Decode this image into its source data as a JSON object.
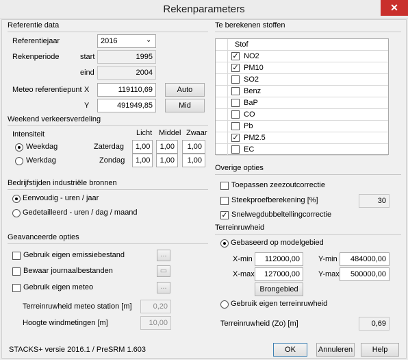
{
  "window": {
    "title": "Rekenparameters",
    "close_glyph": "✕"
  },
  "referentie": {
    "section": "Referentie data",
    "jaar_label": "Referentiejaar",
    "jaar_value": "2016",
    "periode_label": "Rekenperiode",
    "start_label": "start",
    "start_value": "1995",
    "eind_label": "eind",
    "eind_value": "2004",
    "meteo_label": "Meteo referentiepunt",
    "x_label": "X",
    "x_value": "119110,69",
    "y_label": "Y",
    "y_value": "491949,85",
    "auto_btn": "Auto",
    "mid_btn": "Mid"
  },
  "weekend": {
    "section": "Weekend verkeersverdeling",
    "intensiteit_label": "Intensiteit",
    "col_licht": "Licht",
    "col_middel": "Middel",
    "col_zwaar": "Zwaar",
    "weekdag_label": "Weekdag",
    "werkdag_label": "Werkdag",
    "zaterdag_label": "Zaterdag",
    "zondag_label": "Zondag",
    "zaterdag_values": [
      "1,00",
      "1,00",
      "1,00"
    ],
    "zondag_values": [
      "1,00",
      "1,00",
      "1,00"
    ]
  },
  "bedrijf": {
    "section": "Bedrijfstijden industriële bronnen",
    "opt1": "Eenvoudig - uren / jaar",
    "opt2": "Gedetailleerd - uren / dag / maand"
  },
  "geavanceerd": {
    "section": "Geavanceerde opties",
    "opt_emissie": "Gebruik eigen emissiebestand",
    "opt_journaal": "Bewaar journaalbestanden",
    "opt_meteo": "Gebruik eigen meteo",
    "ruwheid_label": "Terreinruwheid meteo station [m]",
    "ruwheid_value": "0,20",
    "hoogte_label": "Hoogte windmetingen [m]",
    "hoogte_value": "10,00",
    "ellipsis": "..."
  },
  "stoffen": {
    "section": "Te berekenen stoffen",
    "header": "Stof",
    "items": [
      {
        "name": "NO2",
        "checked": true
      },
      {
        "name": "PM10",
        "checked": true
      },
      {
        "name": "SO2",
        "checked": false
      },
      {
        "name": "Benz",
        "checked": false
      },
      {
        "name": "BaP",
        "checked": false
      },
      {
        "name": "CO",
        "checked": false
      },
      {
        "name": "Pb",
        "checked": false
      },
      {
        "name": "PM2.5",
        "checked": true
      },
      {
        "name": "EC",
        "checked": false
      }
    ]
  },
  "overige": {
    "section": "Overige opties",
    "opt_zeezout": "Toepassen zeezoutcorrectie",
    "opt_steekproef": "Steekproefberekening [%]",
    "steekproef_value": "30",
    "opt_snelweg": "Snelwegdubbeltellingcorrectie"
  },
  "terrein": {
    "section": "Terreinruwheid",
    "opt_model": "Gebaseerd op modelgebied",
    "xmin_label": "X-min",
    "xmin_value": "112000,00",
    "ymin_label": "Y-min",
    "ymin_value": "484000,00",
    "xmax_label": "X-max",
    "xmax_value": "127000,00",
    "ymax_label": "Y-max",
    "ymax_value": "500000,00",
    "brongebied_btn": "Brongebied",
    "opt_eigen": "Gebruik eigen terreinruwheid",
    "zo_label": "Terreinruwheid (Zo) [m]",
    "zo_value": "0,69"
  },
  "footer": {
    "version": "STACKS+ versie 2016.1 / PreSRM 1.603",
    "ok_btn": "OK",
    "cancel_btn": "Annuleren",
    "help_btn": "Help"
  }
}
